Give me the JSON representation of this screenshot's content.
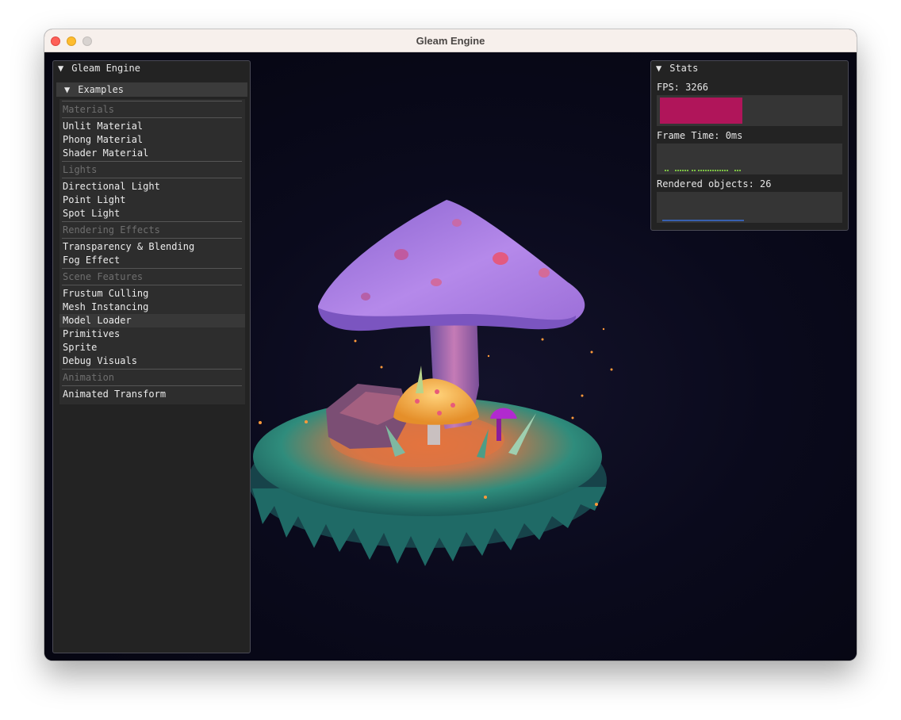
{
  "window": {
    "title": "Gleam Engine"
  },
  "left_panel": {
    "title": "Gleam Engine",
    "examples_header": "Examples",
    "sections": [
      {
        "category": "Materials",
        "items": [
          "Unlit Material",
          "Phong Material",
          "Shader Material"
        ]
      },
      {
        "category": "Lights",
        "items": [
          "Directional Light",
          "Point Light",
          "Spot Light"
        ]
      },
      {
        "category": "Rendering Effects",
        "items": [
          "Transparency & Blending",
          "Fog Effect"
        ]
      },
      {
        "category": "Scene Features",
        "items": [
          "Frustum Culling",
          "Mesh Instancing",
          "Model Loader",
          "Primitives",
          "Sprite",
          "Debug Visuals"
        ]
      },
      {
        "category": "Animation",
        "items": [
          "Animated Transform"
        ]
      }
    ],
    "selected_item": "Model Loader"
  },
  "stats_panel": {
    "title": "Stats",
    "fps_label": "FPS: 3266",
    "fps_bar_fill": 0.46,
    "frame_time_label": "Frame Time: 0ms",
    "rendered_objects_label": "Rendered objects: 26"
  },
  "colors": {
    "fps_bar": "#b0155a",
    "frame_time_plot": "#7bc043",
    "objects_plot": "#3a6fd8",
    "mushroom_cap": "#a377e0",
    "small_cap": "#f2a93b",
    "grass": "#2f8c7c"
  }
}
